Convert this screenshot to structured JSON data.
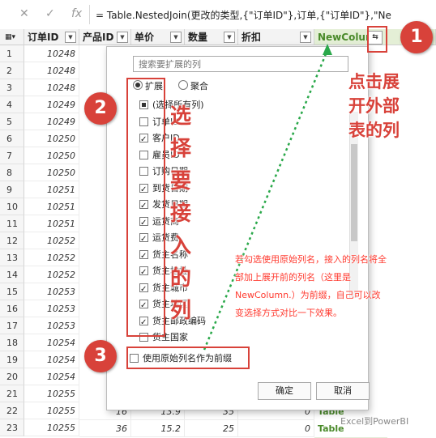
{
  "formula_bar": {
    "cancel_icon": "✕",
    "confirm_icon": "✓",
    "fx_label": "fx",
    "formula": "= Table.NestedJoin(更改的类型,{\"订单ID\"},订单,{\"订单ID\"},\"Ne"
  },
  "grid": {
    "headers": [
      "订单ID",
      "产品ID",
      "单价",
      "数量",
      "折扣",
      "NewColumn"
    ],
    "row_numbers": [
      "1",
      "2",
      "3",
      "4",
      "5",
      "6",
      "7",
      "8",
      "9",
      "10",
      "11",
      "12",
      "13",
      "14",
      "15",
      "16",
      "17",
      "18",
      "19",
      "20",
      "21",
      "22",
      "23"
    ],
    "order_ids": [
      "10248",
      "10248",
      "10248",
      "10249",
      "10249",
      "10250",
      "10250",
      "10250",
      "10251",
      "10251",
      "10251",
      "10252",
      "10252",
      "10252",
      "10253",
      "10253",
      "10253",
      "10254",
      "10254",
      "10254",
      "10255",
      "10255",
      "10255"
    ],
    "row22": {
      "product_id": "16",
      "price": "13.9",
      "qty": "35",
      "discount": "0",
      "newcol": "Table"
    },
    "row23": {
      "product_id": "36",
      "price": "15.2",
      "qty": "25",
      "discount": "0",
      "newcol": "Table"
    }
  },
  "popup": {
    "search_placeholder": "搜索要扩展的列",
    "radio_expand": "扩展",
    "radio_aggregate": "聚合",
    "columns": [
      {
        "label": "(选择所有列)",
        "state": "partial"
      },
      {
        "label": "订单ID",
        "state": "off"
      },
      {
        "label": "客户ID",
        "state": "on"
      },
      {
        "label": "雇员ID",
        "state": "off"
      },
      {
        "label": "订购日期",
        "state": "off"
      },
      {
        "label": "到货日期",
        "state": "on"
      },
      {
        "label": "发货日期",
        "state": "on"
      },
      {
        "label": "运货商",
        "state": "on"
      },
      {
        "label": "运货费",
        "state": "on"
      },
      {
        "label": "货主名称",
        "state": "on"
      },
      {
        "label": "货主地址",
        "state": "on"
      },
      {
        "label": "货主城市",
        "state": "on"
      },
      {
        "label": "货主地区",
        "state": "on"
      },
      {
        "label": "货主邮政编码",
        "state": "on"
      },
      {
        "label": "货主国家",
        "state": "off"
      }
    ],
    "prefix_label": "使用原始列名作为前缀",
    "ok_label": "确定",
    "cancel_label": "取消"
  },
  "annotations": {
    "step1": "1",
    "step2": "2",
    "step3": "3",
    "note1": "点击展开外部表的列",
    "note2": "选择要接入的列",
    "note3": "若勾选使用原始列名，接入的列名将全部加上展开前的列名（这里是NewColumn.）为前缀，自己可以改变选择方式对比一下效果。",
    "accent_color": "#d8423a",
    "watermark": "Excel到PowerBI"
  }
}
